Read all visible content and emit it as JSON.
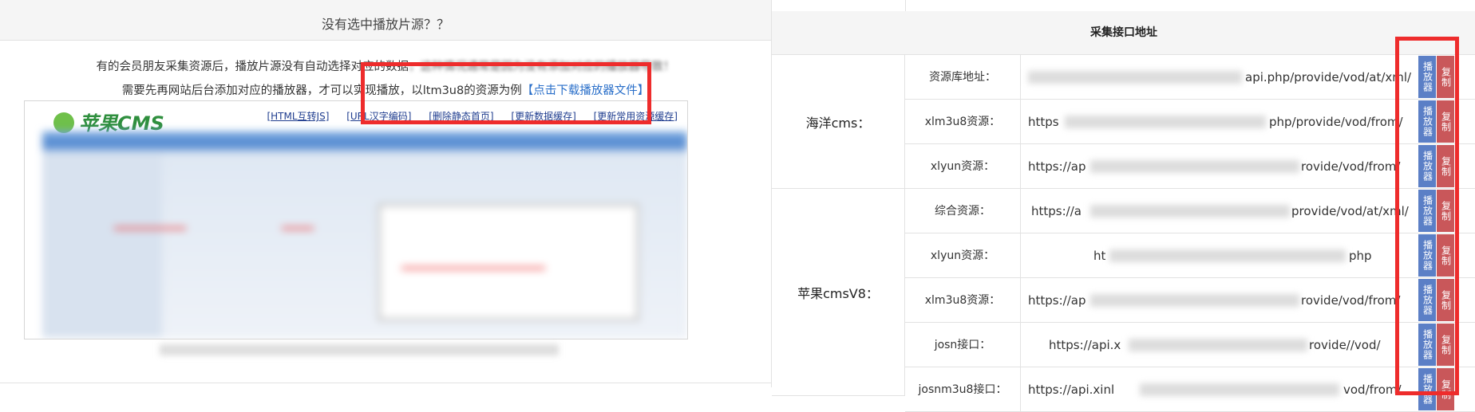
{
  "left": {
    "title": "没有选中播放片源？？",
    "desc1_visible": "有的会员朋友采集资源后，播放片源没有自动选择对应的数据",
    "desc1_faded": "，这种情况通常是因为没有添加对应的播放器导致！",
    "desc2_text": "需要先再网站后台添加对应的播放器，才可以实现播放，以ltm3u8的资源为例",
    "desc2_link": "【点击下载播放器文件】",
    "screenshot": {
      "logo_text": "苹果CMS",
      "links": [
        "[HTML互转JS]",
        "[URL汉字编码]",
        "[删除静态首页]",
        "[更新数据缓存]",
        "[更新常用资源缓存]"
      ]
    }
  },
  "right": {
    "header": "采集接口地址",
    "button_play": "播放器",
    "button_copy": "复制",
    "groups": [
      {
        "name": "海洋cms：",
        "rows": [
          {
            "label": "资源库地址：",
            "url_start": "",
            "url_end": "api.php/provide/vod/at/xml/"
          },
          {
            "label": "xlm3u8资源：",
            "url_start": "https",
            "url_end": "php/provide/vod/from/"
          },
          {
            "label": "xlyun资源：",
            "url_start": "https://ap",
            "url_end": "rovide/vod/from/"
          }
        ]
      },
      {
        "name": "苹果cmsV8：",
        "rows": [
          {
            "label": "综合资源：",
            "url_start": "https://a",
            "url_end": "provide/vod/at/xml/"
          },
          {
            "label": "xlyun资源：",
            "url_start": "ht",
            "url_end": "php"
          },
          {
            "label": "xlm3u8资源：",
            "url_start": "https://ap",
            "url_end": "rovide/vod/from/"
          },
          {
            "label": "josn接口：",
            "url_start": "https://api.x",
            "url_end": "rovide//vod/"
          },
          {
            "label": "josnm3u8接口：",
            "url_start": "https://api.xinl",
            "url_end": "vod/from/"
          }
        ]
      }
    ]
  },
  "colors": {
    "accent_red": "#ee2c2c",
    "button_blue": "#5b7fc6",
    "button_red": "#c9575a",
    "link_blue": "#2a6fc9"
  }
}
